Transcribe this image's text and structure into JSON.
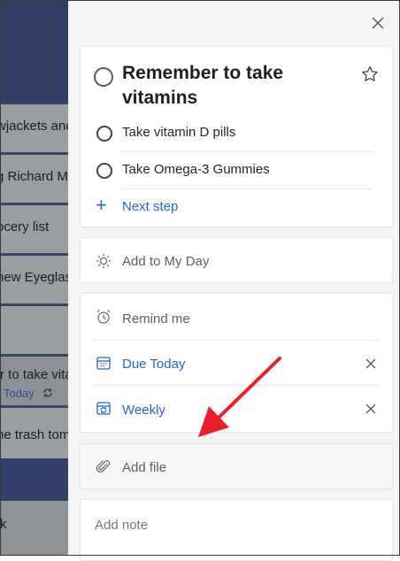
{
  "task_list": {
    "rows": [
      {
        "text": "wjackets and"
      },
      {
        "text": "g Richard M"
      },
      {
        "text": "ocery list"
      },
      {
        "text": "new Eyeglass"
      },
      {
        "text": ""
      },
      {
        "text": "r to take vita",
        "due": "Today"
      },
      {
        "text": "he trash tom"
      },
      {
        "text": "k"
      }
    ]
  },
  "detail": {
    "task_title": "Remember to take vitamins",
    "steps": [
      {
        "label": "Take vitamin D pills"
      },
      {
        "label": "Take Omega-3 Gummies"
      }
    ],
    "next_step_label": "Next step",
    "add_to_my_day_label": "Add to My Day",
    "remind_me_label": "Remind me",
    "due_label": "Due Today",
    "repeat_label": "Weekly",
    "add_file_label": "Add file",
    "note_placeholder": "Add note"
  },
  "colors": {
    "accent": "#2564cf",
    "annotation_arrow": "#e8202a"
  },
  "icons": [
    "close-icon",
    "star-icon",
    "plus-icon",
    "sun-icon",
    "alarm-clock-icon",
    "calendar-icon",
    "repeat-icon",
    "paperclip-icon",
    "recurring-icon"
  ]
}
